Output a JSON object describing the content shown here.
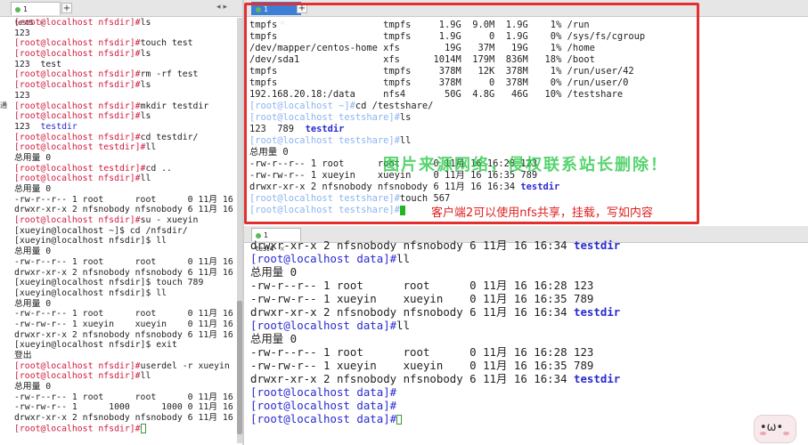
{
  "left_pane": {
    "tab": {
      "label": "1 test5",
      "close": "×"
    },
    "side_label": "通",
    "lines": [
      [
        {
          "t": "[root@localhost nfsdir]#",
          "c": "prompt"
        },
        {
          "t": "ls"
        }
      ],
      [
        {
          "t": "123"
        }
      ],
      [
        {
          "t": "[root@localhost nfsdir]#",
          "c": "prompt"
        },
        {
          "t": "touch test"
        }
      ],
      [
        {
          "t": "[root@localhost nfsdir]#",
          "c": "prompt"
        },
        {
          "t": "ls"
        }
      ],
      [
        {
          "t": "123  test"
        }
      ],
      [
        {
          "t": "[root@localhost nfsdir]#",
          "c": "prompt"
        },
        {
          "t": "rm -rf test"
        }
      ],
      [
        {
          "t": "[root@localhost nfsdir]#",
          "c": "prompt"
        },
        {
          "t": "ls"
        }
      ],
      [
        {
          "t": "123"
        }
      ],
      [
        {
          "t": "[root@localhost nfsdir]#",
          "c": "prompt"
        },
        {
          "t": "mkdir testdir"
        }
      ],
      [
        {
          "t": "[root@localhost nfsdir]#",
          "c": "prompt"
        },
        {
          "t": "ls"
        }
      ],
      [
        {
          "t": "123  "
        },
        {
          "t": "testdir",
          "c": "dir"
        }
      ],
      [
        {
          "t": "[root@localhost nfsdir]#",
          "c": "prompt"
        },
        {
          "t": "cd testdir/"
        }
      ],
      [
        {
          "t": "[root@localhost testdir]#",
          "c": "prompt"
        },
        {
          "t": "ll"
        }
      ],
      [
        {
          "t": "总用量 0"
        }
      ],
      [
        {
          "t": "[root@localhost testdir]#",
          "c": "prompt"
        },
        {
          "t": "cd .."
        }
      ],
      [
        {
          "t": "[root@localhost nfsdir]#",
          "c": "prompt"
        },
        {
          "t": "ll"
        }
      ],
      [
        {
          "t": "总用量 0"
        }
      ],
      [
        {
          "t": "-rw-r--r-- 1 root      root      0 11月 16"
        }
      ],
      [
        {
          "t": "drwxr-xr-x 2 nfsnobody nfsnobody 6 11月 16"
        }
      ],
      [
        {
          "t": "[root@localhost nfsdir]#",
          "c": "prompt"
        },
        {
          "t": "su - xueyin"
        }
      ],
      [
        {
          "t": "[xueyin@localhost ~]$ cd /nfsdir/"
        }
      ],
      [
        {
          "t": "[xueyin@localhost nfsdir]$ ll"
        }
      ],
      [
        {
          "t": "总用量 0"
        }
      ],
      [
        {
          "t": "-rw-r--r-- 1 root      root      0 11月 16"
        }
      ],
      [
        {
          "t": "drwxr-xr-x 2 nfsnobody nfsnobody 6 11月 16"
        }
      ],
      [
        {
          "t": "[xueyin@localhost nfsdir]$ touch 789"
        }
      ],
      [
        {
          "t": "[xueyin@localhost nfsdir]$ ll"
        }
      ],
      [
        {
          "t": "总用量 0"
        }
      ],
      [
        {
          "t": "-rw-r--r-- 1 root      root      0 11月 16"
        }
      ],
      [
        {
          "t": "-rw-rw-r-- 1 xueyin    xueyin    0 11月 16"
        }
      ],
      [
        {
          "t": "drwxr-xr-x 2 nfsnobody nfsnobody 6 11月 16"
        }
      ],
      [
        {
          "t": "[xueyin@localhost nfsdir]$ exit"
        }
      ],
      [
        {
          "t": "登出"
        }
      ],
      [
        {
          "t": "[root@localhost nfsdir]#",
          "c": "prompt"
        },
        {
          "t": "userdel -r xueyin"
        }
      ],
      [
        {
          "t": "[root@localhost nfsdir]#",
          "c": "prompt"
        },
        {
          "t": "ll"
        }
      ],
      [
        {
          "t": "总用量 0"
        }
      ],
      [
        {
          "t": "-rw-r--r-- 1 root      root      0 11月 16"
        }
      ],
      [
        {
          "t": "-rw-rw-r-- 1      1000      1000 0 11月 16"
        }
      ],
      [
        {
          "t": "drwxr-xr-x 2 nfsnobody nfsnobody 6 11月 16"
        }
      ],
      [
        {
          "t": "[root@localhost nfsdir]#",
          "c": "prompt"
        },
        {
          "cursor": "outline"
        }
      ]
    ]
  },
  "top_right_pane": {
    "tab": {
      "label": "1 test1",
      "close": "×"
    },
    "add_tab": "+",
    "lines": [
      [
        {
          "t": "tmpfs                   tmpfs     1.9G  9.0M  1.9G    1% /run"
        }
      ],
      [
        {
          "t": "tmpfs                   tmpfs     1.9G     0  1.9G    0% /sys/fs/cgroup"
        }
      ],
      [
        {
          "t": "/dev/mapper/centos-home xfs        19G   37M   19G    1% /home"
        }
      ],
      [
        {
          "t": "/dev/sda1               xfs      1014M  179M  836M   18% /boot"
        }
      ],
      [
        {
          "t": "tmpfs                   tmpfs     378M   12K  378M    1% /run/user/42"
        }
      ],
      [
        {
          "t": "tmpfs                   tmpfs     378M     0  378M    0% /run/user/0"
        }
      ],
      [
        {
          "t": "192.168.20.18:/data     nfs4       50G  4.8G   46G   10% /testshare"
        }
      ],
      [
        {
          "t": "[root@localhost ~]#",
          "c": "prompt-faint"
        },
        {
          "t": "cd /testshare/"
        }
      ],
      [
        {
          "t": "[root@localhost testshare]#",
          "c": "prompt-faint"
        },
        {
          "t": "ls"
        }
      ],
      [
        {
          "t": "123  789  "
        },
        {
          "t": "testdir",
          "c": "dir-bold"
        }
      ],
      [
        {
          "t": "[root@localhost testshare]#",
          "c": "prompt-faint"
        },
        {
          "t": "ll"
        }
      ],
      [
        {
          "t": "总用量 0"
        }
      ],
      [
        {
          "t": "-rw-r--r-- 1 root      root      0 11月 16 16:28 123"
        }
      ],
      [
        {
          "t": "-rw-rw-r-- 1 xueyin    xueyin    0 11月 16 16:35 789"
        }
      ],
      [
        {
          "t": "drwxr-xr-x 2 nfsnobody nfsnobody 6 11月 16 16:34 "
        },
        {
          "t": "testdir",
          "c": "dir-bold"
        }
      ],
      [
        {
          "t": "[root@localhost testshare]#",
          "c": "prompt-faint"
        },
        {
          "t": "touch 567"
        }
      ],
      [
        {
          "t": "[root@localhost testshare]#",
          "c": "prompt-faint"
        },
        {
          "cursor": "fill"
        }
      ]
    ]
  },
  "bottom_right_pane": {
    "tab": {
      "label": "1 test4",
      "close": "×"
    },
    "lines": [
      [
        {
          "t": "drwxr-xr-x 2 nfsnobody nfsnobody 6 11月 16 16:34 "
        },
        {
          "t": "testdir",
          "c": "dir-bold"
        }
      ],
      [
        {
          "t": "[root@localhost data]#",
          "c": "prompt2"
        },
        {
          "t": "ll"
        }
      ],
      [
        {
          "t": "总用量 0"
        }
      ],
      [
        {
          "t": "-rw-r--r-- 1 root      root      0 11月 16 16:28 123"
        }
      ],
      [
        {
          "t": "-rw-rw-r-- 1 xueyin    xueyin    0 11月 16 16:35 789"
        }
      ],
      [
        {
          "t": "drwxr-xr-x 2 nfsnobody nfsnobody 6 11月 16 16:34 "
        },
        {
          "t": "testdir",
          "c": "dir-bold"
        }
      ],
      [
        {
          "t": "[root@localhost data]#",
          "c": "prompt2"
        },
        {
          "t": "ll"
        }
      ],
      [
        {
          "t": "总用量 0"
        }
      ],
      [
        {
          "t": "-rw-r--r-- 1 root      root      0 11月 16 16:28 123"
        }
      ],
      [
        {
          "t": "-rw-rw-r-- 1 xueyin    xueyin    0 11月 16 16:35 789"
        }
      ],
      [
        {
          "t": "drwxr-xr-x 2 nfsnobody nfsnobody 6 11月 16 16:34 "
        },
        {
          "t": "testdir",
          "c": "dir-bold"
        }
      ],
      [
        {
          "t": "[root@localhost data]#",
          "c": "prompt2"
        }
      ],
      [
        {
          "t": "[root@localhost data]#",
          "c": "prompt2"
        }
      ],
      [
        {
          "t": "[root@localhost data]#",
          "c": "prompt2"
        },
        {
          "cursor": "outline"
        }
      ]
    ]
  },
  "overlays": {
    "watermark": "图片来源网络，侵权联系站长删除！",
    "annotation": "客户端2可以使用nfs共享，挂载，写如内容",
    "sticker_face": "•ω•"
  },
  "colors": {
    "prompt_red": "#d11a3c",
    "prompt_blue": "#2a2ad0",
    "active_tab": "#3d7fd6",
    "highlight_box": "#e23030",
    "watermark_green": "#28c846"
  }
}
